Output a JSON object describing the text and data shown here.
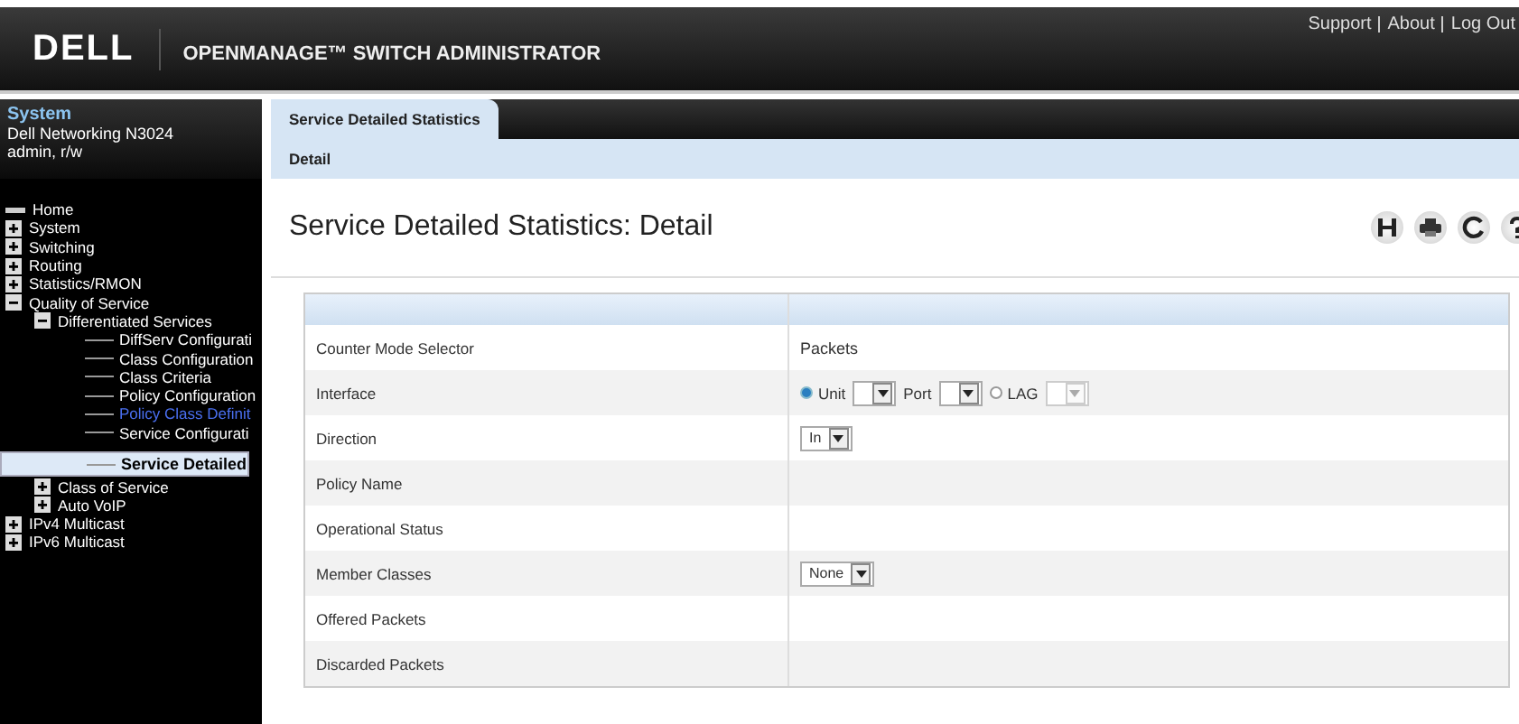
{
  "header": {
    "logo": "DELL",
    "product": "OPENMANAGE™ SWITCH ADMINISTRATOR",
    "links": [
      "Support",
      "About",
      "Log Out"
    ]
  },
  "sidebar": {
    "title": "System",
    "device": "Dell Networking N3024",
    "user": "admin, r/w",
    "tree": [
      {
        "label": "Home",
        "kind": "home",
        "selected": false
      },
      {
        "label": "System",
        "kind": "folder",
        "expanded": false,
        "selected": false
      },
      {
        "label": "Switching",
        "kind": "folder",
        "expanded": false,
        "selected": false
      },
      {
        "label": "Routing",
        "kind": "folder",
        "expanded": false,
        "selected": false
      },
      {
        "label": "Statistics/RMON",
        "kind": "folder",
        "expanded": false,
        "selected": false
      },
      {
        "label": "Quality of Service",
        "kind": "folder",
        "expanded": true,
        "selected": false,
        "children": [
          {
            "label": "Differentiated Services",
            "kind": "folder",
            "expanded": true,
            "selected": false,
            "children": [
              {
                "label": "DiffServ Configurati",
                "kind": "page",
                "visited": false,
                "selected": false
              },
              {
                "label": "Class Configuration",
                "kind": "page",
                "visited": false,
                "selected": false
              },
              {
                "label": "Class Criteria",
                "kind": "page",
                "visited": false,
                "selected": false
              },
              {
                "label": "Policy Configuration",
                "kind": "page",
                "visited": false,
                "selected": false
              },
              {
                "label": "Policy Class Definit",
                "kind": "page",
                "visited": true,
                "selected": false
              },
              {
                "label": "Service Configurati",
                "kind": "page",
                "visited": false,
                "selected": false
              },
              {
                "label": "Service Detailed",
                "kind": "page",
                "visited": false,
                "selected": true
              }
            ]
          },
          {
            "label": "Class of Service",
            "kind": "folder",
            "expanded": false,
            "selected": false
          },
          {
            "label": "Auto VoIP",
            "kind": "folder",
            "expanded": false,
            "selected": false
          }
        ]
      },
      {
        "label": "IPv4 Multicast",
        "kind": "folder",
        "expanded": false,
        "selected": false
      },
      {
        "label": "IPv6 Multicast",
        "kind": "folder",
        "expanded": false,
        "selected": false
      }
    ]
  },
  "tabs": [
    {
      "label": "Service Detailed Statistics",
      "selected": true
    }
  ],
  "subtabs": [
    {
      "label": "Detail",
      "selected": true
    }
  ],
  "page_title": "Service Detailed Statistics: Detail",
  "toolbar": [
    {
      "kind": "save"
    },
    {
      "kind": "print"
    },
    {
      "kind": "refresh"
    },
    {
      "kind": "help"
    }
  ],
  "form": [
    {
      "label": "Counter Mode Selector",
      "kind": "text",
      "value": "Packets"
    },
    {
      "label": "Interface",
      "kind": "interface",
      "options": [
        {
          "kind": "radio",
          "label": "Unit",
          "selected": true
        },
        {
          "kind": "select",
          "disabled": false
        },
        {
          "kind": "label",
          "label": "Port"
        },
        {
          "kind": "select",
          "disabled": false
        },
        {
          "kind": "radio",
          "label": "LAG",
          "selected": false
        },
        {
          "kind": "select",
          "disabled": true
        }
      ]
    },
    {
      "label": "Direction",
      "kind": "select",
      "value": "In"
    },
    {
      "label": "Policy Name",
      "kind": "empty"
    },
    {
      "label": "Operational Status",
      "kind": "empty"
    },
    {
      "label": "Member Classes",
      "kind": "select",
      "value": "None"
    },
    {
      "label": "Offered Packets",
      "kind": "empty"
    },
    {
      "label": "Discarded Packets",
      "kind": "empty"
    }
  ]
}
